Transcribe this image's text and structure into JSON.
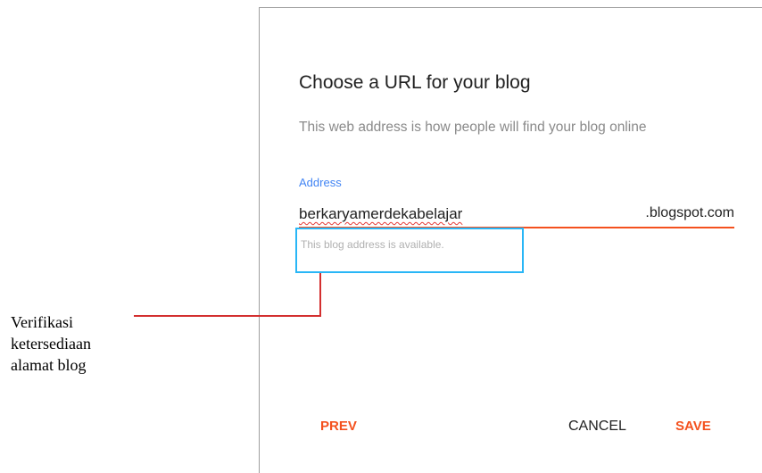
{
  "dialog": {
    "title": "Choose a URL for your blog",
    "subtitle": "This web address is how people will find your blog online",
    "address_label": "Address",
    "address_value": "berkaryamerdekabelajar",
    "address_suffix": ".blogspot.com",
    "availability_message": "This blog address is available.",
    "prev_label": "PREV",
    "cancel_label": "CANCEL",
    "save_label": "SAVE"
  },
  "annotation": {
    "lines": [
      "Verifikasi",
      "ketersediaan",
      "alamat blog"
    ]
  },
  "colors": {
    "accent": "#f4511e",
    "label_blue": "#4285f4",
    "highlight_box": "#29b6f6",
    "callout_line": "#d32f2f"
  }
}
